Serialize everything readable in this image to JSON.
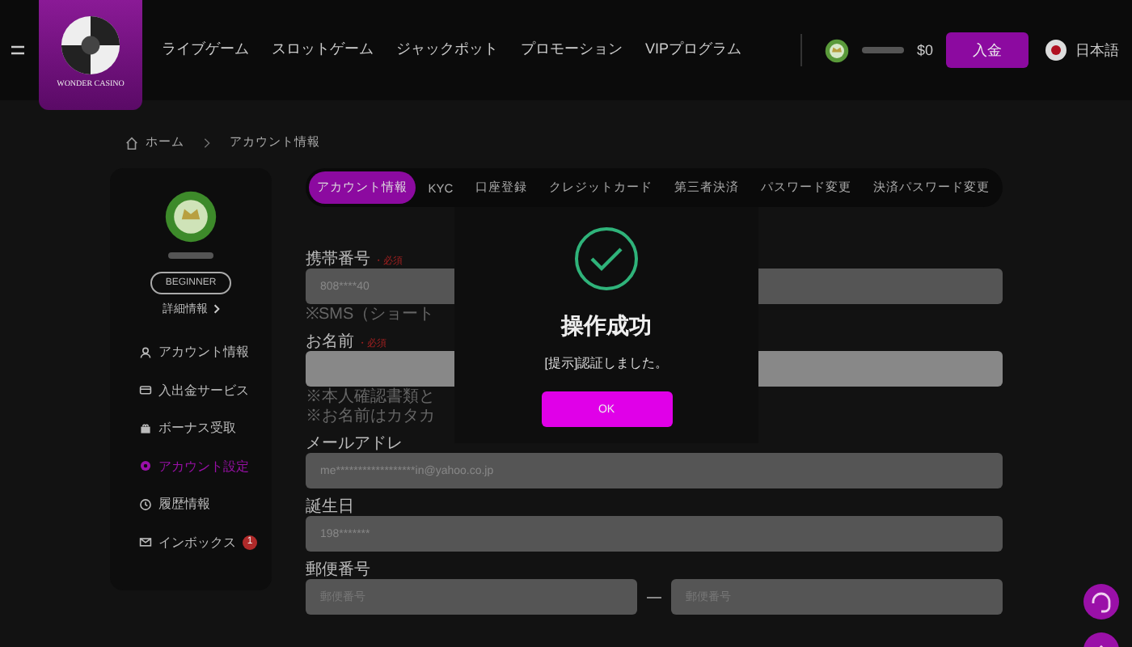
{
  "header": {
    "brand": "WONDER CASINO",
    "nav": [
      "ライブゲーム",
      "スロットゲーム",
      "ジャックポット",
      "プロモーション",
      "VIPプログラム"
    ],
    "balance": "$0",
    "deposit_button": "入金",
    "language": "日本語"
  },
  "breadcrumb": [
    "ホーム",
    "アカウント情報"
  ],
  "profile": {
    "level_badge": "BEGINNER",
    "details_link": "詳細情報"
  },
  "sidebar_menu": [
    {
      "label": "アカウント情報",
      "selected": false
    },
    {
      "label": "入出金サービス",
      "selected": false
    },
    {
      "label": "ボーナス受取",
      "selected": false
    },
    {
      "label": "アカウント設定",
      "selected": true
    },
    {
      "label": "履歴情報",
      "selected": false
    },
    {
      "label": "インボックス",
      "selected": false,
      "badge": "1"
    }
  ],
  "tabs": [
    {
      "label": "アカウント情報",
      "selected": true
    },
    {
      "label": "KYC",
      "selected": false
    },
    {
      "label": "口座登録",
      "selected": false
    },
    {
      "label": "クレジットカード",
      "selected": false
    },
    {
      "label": "第三者決済",
      "selected": false
    },
    {
      "label": "パスワード変更",
      "selected": false
    },
    {
      "label": "決済パスワード変更",
      "selected": false
    }
  ],
  "form": {
    "fields": [
      {
        "label": "携帯番号",
        "required_mark": "・必須",
        "value": "808****40",
        "hints": [
          "※SMS（ショート"
        ]
      },
      {
        "label": "お名前",
        "required_mark": "・必須",
        "hints": [
          "※本人確認書類と",
          "※お名前はカタカ"
        ]
      },
      {
        "label": "メールアドレ",
        "value": "me******************in@yahoo.co.jp"
      },
      {
        "label": "誕生日",
        "value": "198*******"
      }
    ],
    "postal": {
      "label": "郵便番号",
      "placeholders": [
        "郵便番号",
        "郵便番号"
      ]
    }
  },
  "dialog": {
    "title": "操作成功",
    "message": "[提示]認証しました。",
    "button": "OK"
  }
}
